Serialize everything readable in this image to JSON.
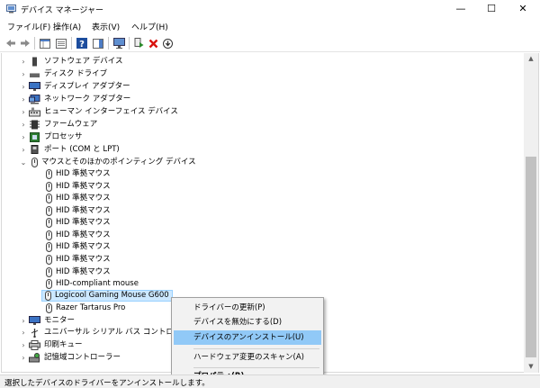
{
  "window": {
    "title": "デバイス マネージャー",
    "minimize": "—",
    "maximize": "☐",
    "close": "✕"
  },
  "menu": [
    "ファイル(F)",
    "操作(A)",
    "表示(V)",
    "ヘルプ(H)"
  ],
  "tree": {
    "categories_top": [
      {
        "label": "ソフトウェア デバイス",
        "icon": "software-device-icon"
      },
      {
        "label": "ディスク ドライブ",
        "icon": "disk-drive-icon"
      },
      {
        "label": "ディスプレイ アダプター",
        "icon": "display-adapter-icon"
      },
      {
        "label": "ネットワーク アダプター",
        "icon": "network-adapter-icon"
      },
      {
        "label": "ヒューマン インターフェイス デバイス",
        "icon": "hid-icon"
      },
      {
        "label": "ファームウェア",
        "icon": "firmware-icon"
      },
      {
        "label": "プロセッサ",
        "icon": "processor-icon"
      },
      {
        "label": "ポート (COM と LPT)",
        "icon": "port-icon"
      }
    ],
    "expanded_category": {
      "label": "マウスとそのほかのポインティング デバイス",
      "icon": "mouse-icon"
    },
    "mouse_devices": [
      "HID 準拠マウス",
      "HID 準拠マウス",
      "HID 準拠マウス",
      "HID 準拠マウス",
      "HID 準拠マウス",
      "HID 準拠マウス",
      "HID 準拠マウス",
      "HID 準拠マウス",
      "HID 準拠マウス",
      "HID-compliant mouse",
      "Logicool Gaming Mouse G600",
      "Razer Tartarus Pro"
    ],
    "selected_device_index": 10,
    "categories_bottom": [
      {
        "label": "モニター",
        "icon": "monitor-icon"
      },
      {
        "label": "ユニバーサル シリアル バス コントローラー",
        "icon": "usb-icon"
      },
      {
        "label": "印刷キュー",
        "icon": "print-queue-icon"
      },
      {
        "label": "記憶域コントローラー",
        "icon": "storage-controller-icon"
      }
    ]
  },
  "context_menu": {
    "items": [
      {
        "label": "ドライバーの更新(P)",
        "highlighted": false,
        "bold": false
      },
      {
        "label": "デバイスを無効にする(D)",
        "highlighted": false,
        "bold": false
      },
      {
        "label": "デバイスのアンインストール(U)",
        "highlighted": true,
        "bold": false
      },
      {
        "label": "ハードウェア変更のスキャン(A)",
        "highlighted": false,
        "bold": false
      },
      {
        "label": "プロパティ(R)",
        "highlighted": false,
        "bold": true
      }
    ]
  },
  "status": "選択したデバイスのドライバーをアンインストールします。",
  "colors": {
    "selection": "#cce8ff",
    "menu_highlight": "#91c9f7",
    "delete_red": "#d9120e",
    "enable_green": "#2a8a2a",
    "help_blue": "#1d4d9e"
  }
}
